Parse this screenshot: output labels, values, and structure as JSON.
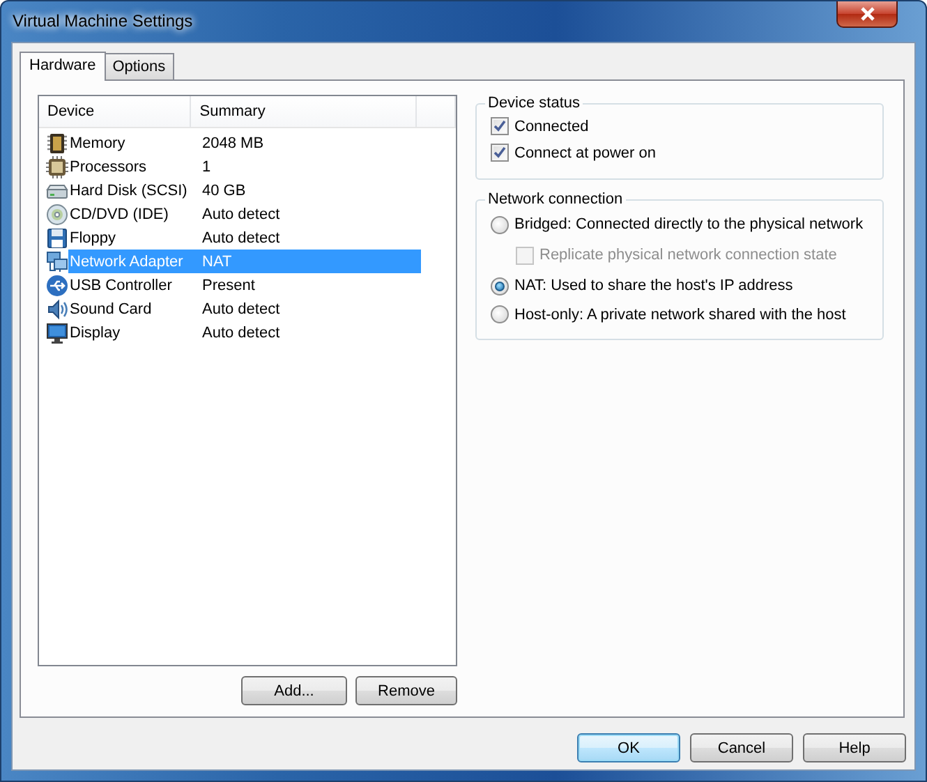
{
  "window": {
    "title": "Virtual Machine Settings"
  },
  "tabs": [
    {
      "label": "Hardware",
      "selected": true
    },
    {
      "label": "Options",
      "selected": false
    }
  ],
  "device_list": {
    "columns": [
      "Device",
      "Summary"
    ],
    "rows": [
      {
        "kind": "memory",
        "device": "Memory",
        "summary": "2048 MB",
        "selected": false
      },
      {
        "kind": "processor",
        "device": "Processors",
        "summary": "1",
        "selected": false
      },
      {
        "kind": "disk",
        "device": "Hard Disk (SCSI)",
        "summary": "40 GB",
        "selected": false
      },
      {
        "kind": "cd",
        "device": "CD/DVD (IDE)",
        "summary": "Auto detect",
        "selected": false
      },
      {
        "kind": "floppy",
        "device": "Floppy",
        "summary": "Auto detect",
        "selected": false
      },
      {
        "kind": "network",
        "device": "Network Adapter",
        "summary": "NAT",
        "selected": true
      },
      {
        "kind": "usb",
        "device": "USB Controller",
        "summary": "Present",
        "selected": false
      },
      {
        "kind": "sound",
        "device": "Sound Card",
        "summary": "Auto detect",
        "selected": false
      },
      {
        "kind": "display",
        "device": "Display",
        "summary": "Auto detect",
        "selected": false
      }
    ]
  },
  "list_buttons": [
    "Add...",
    "Remove"
  ],
  "device_status": {
    "title": "Device status",
    "options": [
      {
        "label": "Connected",
        "checked": true,
        "disabled": false
      },
      {
        "label": "Connect at power on",
        "checked": true,
        "disabled": false
      }
    ]
  },
  "network_connection": {
    "title": "Network connection",
    "options": [
      {
        "kind": "radio",
        "label": "Bridged: Connected directly to the physical network",
        "selected": false,
        "disabled": false
      },
      {
        "kind": "checkbox",
        "label": "Replicate physical network connection state",
        "checked": false,
        "disabled": true
      },
      {
        "kind": "radio",
        "label": "NAT: Used to share the host's IP address",
        "selected": true,
        "disabled": false
      },
      {
        "kind": "radio",
        "label": "Host-only: A private network shared with the host",
        "selected": false,
        "disabled": false
      }
    ]
  },
  "dialog_buttons": [
    {
      "label": "OK",
      "default": true
    },
    {
      "label": "Cancel",
      "default": false
    },
    {
      "label": "Help",
      "default": false
    }
  ]
}
